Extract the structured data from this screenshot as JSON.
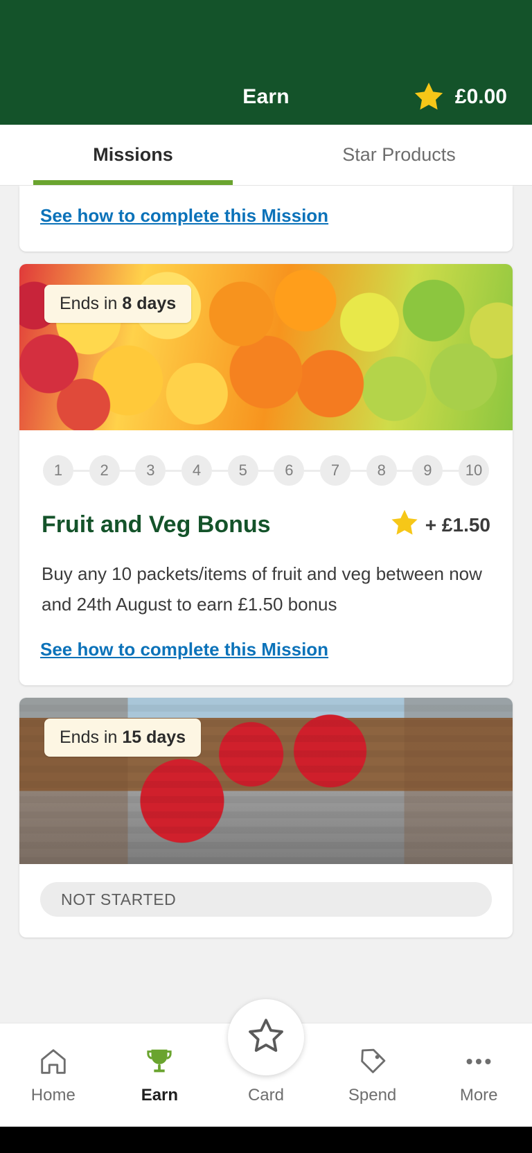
{
  "header": {
    "title": "Earn",
    "balance": "£0.00",
    "star_icon": "star-filled-icon",
    "bg_color": "#14532a"
  },
  "tabs": [
    {
      "label": "Missions",
      "active": true
    },
    {
      "label": "Star Products",
      "active": false
    }
  ],
  "top_card": {
    "link_label": "See how to complete this Mission"
  },
  "missions": [
    {
      "badge_prefix": "Ends in ",
      "badge_value": "8 days",
      "steps": [
        "1",
        "2",
        "3",
        "4",
        "5",
        "6",
        "7",
        "8",
        "9",
        "10"
      ],
      "title": "Fruit and Veg Bonus",
      "reward_icon": "star-filled-icon",
      "reward": "+ £1.50",
      "description": "Buy any 10 packets/items of fruit and veg between now and 24th August to earn £1.50 bonus",
      "link_label": "See how to complete this Mission",
      "image": "fruit-and-veg-photo"
    },
    {
      "badge_prefix": "Ends in ",
      "badge_value": "15 days",
      "status": "NOT STARTED",
      "image": "school-uniform-photo"
    }
  ],
  "fab": {
    "icon": "star-outline-icon"
  },
  "bottom_nav": [
    {
      "label": "Home",
      "icon": "home-icon",
      "active": false
    },
    {
      "label": "Earn",
      "icon": "trophy-icon",
      "active": true
    },
    {
      "label": "Card",
      "icon": "star-outline-icon",
      "active": false
    },
    {
      "label": "Spend",
      "icon": "tag-icon",
      "active": false
    },
    {
      "label": "More",
      "icon": "ellipsis-icon",
      "active": false
    }
  ],
  "colors": {
    "brand_green": "#14532a",
    "accent_green": "#6aa42f",
    "link_blue": "#0b72b9",
    "star_gold": "#f6c718"
  }
}
